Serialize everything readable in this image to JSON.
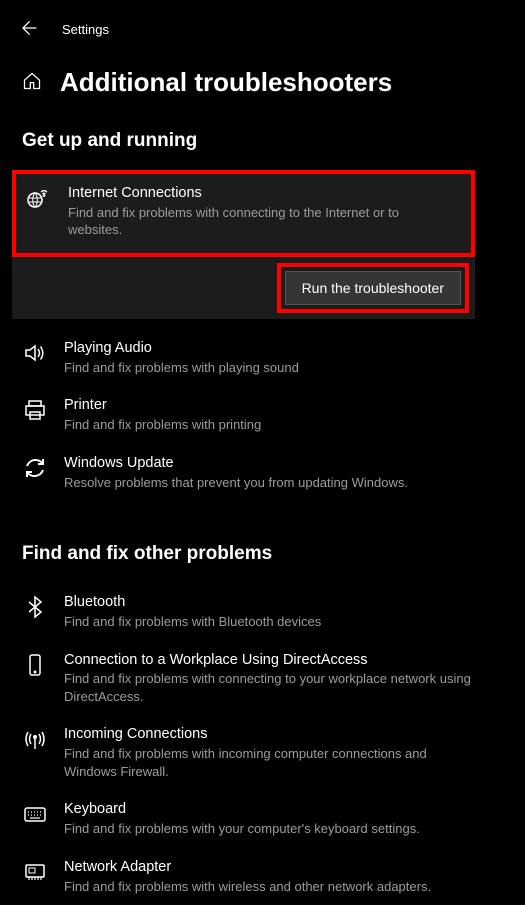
{
  "header": {
    "app_title": "Settings"
  },
  "page": {
    "title": "Additional troubleshooters"
  },
  "sections": {
    "running": {
      "title": "Get up and running",
      "internet": {
        "title": "Internet Connections",
        "desc": "Find and fix problems with connecting to the Internet or to websites."
      },
      "run_button": "Run the troubleshooter",
      "audio": {
        "title": "Playing Audio",
        "desc": "Find and fix problems with playing sound"
      },
      "printer": {
        "title": "Printer",
        "desc": "Find and fix problems with printing"
      },
      "update": {
        "title": "Windows Update",
        "desc": "Resolve problems that prevent you from updating Windows."
      }
    },
    "other": {
      "title": "Find and fix other problems",
      "bluetooth": {
        "title": "Bluetooth",
        "desc": "Find and fix problems with Bluetooth devices"
      },
      "directaccess": {
        "title": "Connection to a Workplace Using DirectAccess",
        "desc": "Find and fix problems with connecting to your workplace network using DirectAccess."
      },
      "incoming": {
        "title": "Incoming Connections",
        "desc": "Find and fix problems with incoming computer connections and Windows Firewall."
      },
      "keyboard": {
        "title": "Keyboard",
        "desc": "Find and fix problems with your computer's keyboard settings."
      },
      "network": {
        "title": "Network Adapter",
        "desc": "Find and fix problems with wireless and other network adapters."
      }
    }
  }
}
